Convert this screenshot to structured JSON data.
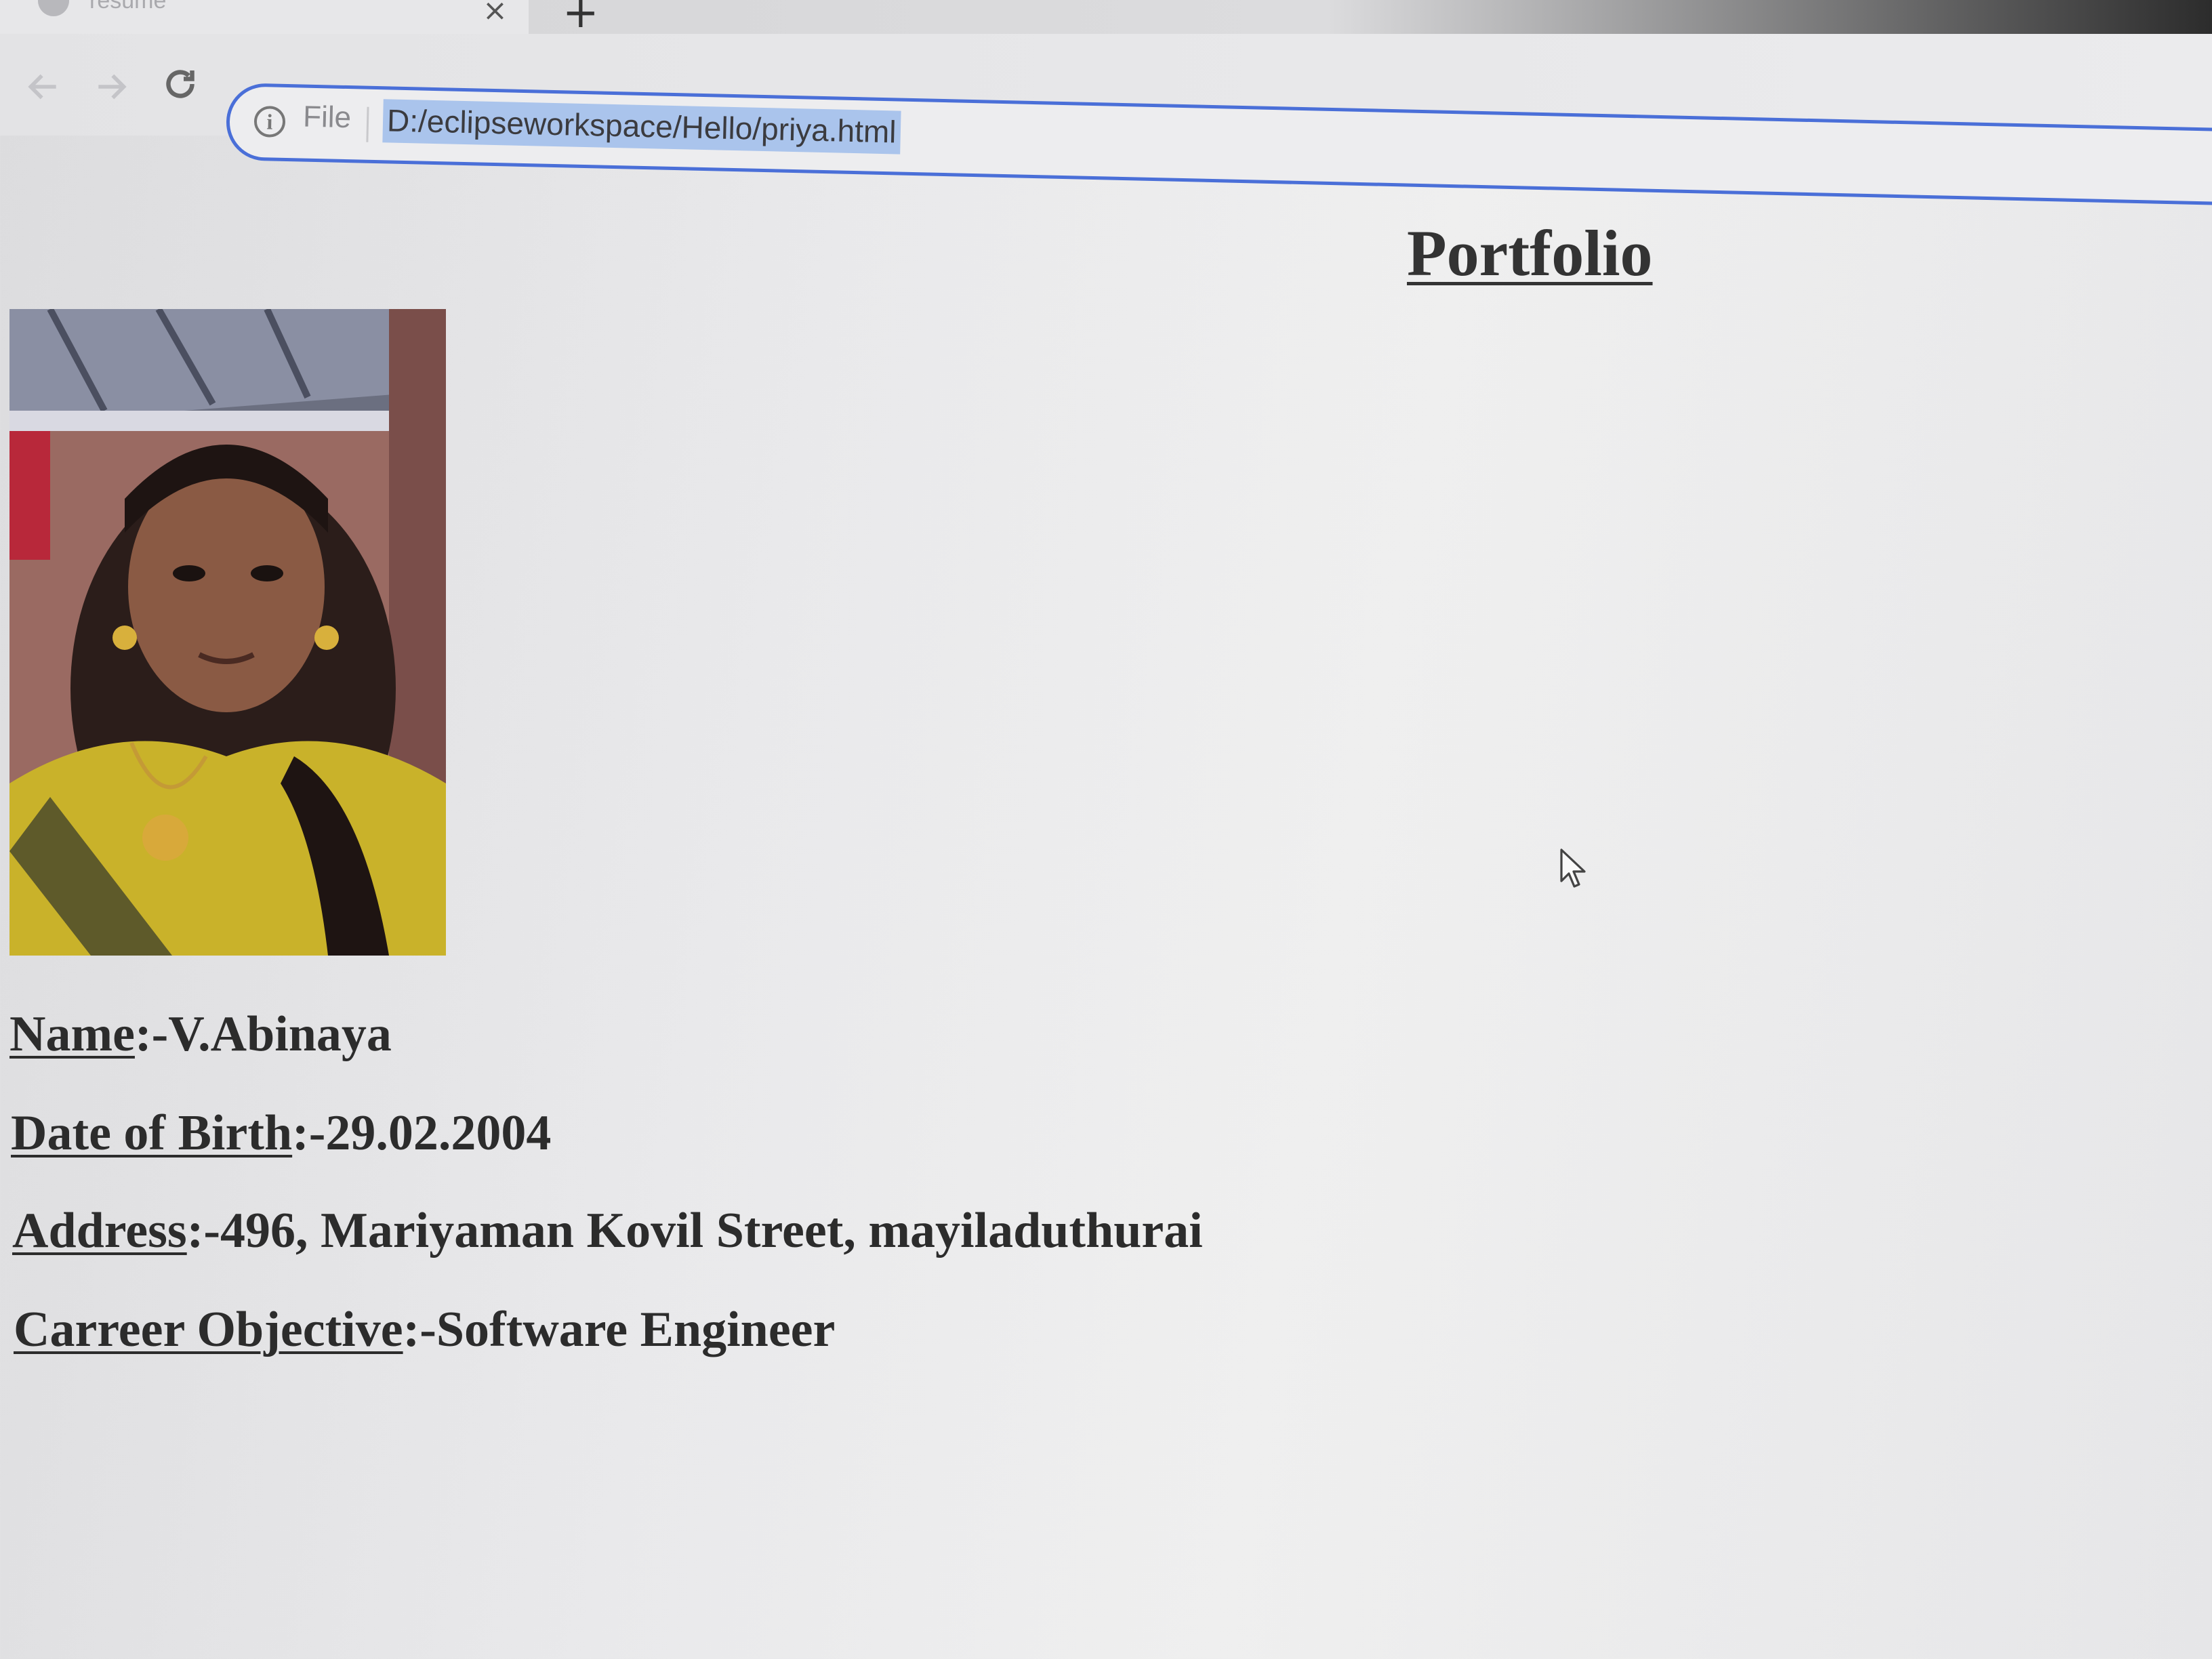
{
  "browser": {
    "tab": {
      "title": "resume",
      "close_glyph": "×"
    },
    "new_tab_glyph": "+",
    "nav": {
      "back_icon": "back-arrow-icon",
      "forward_icon": "forward-arrow-icon",
      "reload_icon": "reload-icon"
    },
    "omnibox": {
      "info_glyph": "i",
      "scheme_label": "File",
      "url": "D:/eclipseworkspace/Hello/priya.html",
      "url_selected": true,
      "focus_color": "#4a6fd8"
    }
  },
  "page": {
    "title": "Portfolio",
    "photo_alt": "profile-photo",
    "fields": [
      {
        "label": "Name",
        "value": ":-V.Abinaya"
      },
      {
        "label": "Date of Birth",
        "value": ":-29.02.2004"
      },
      {
        "label": "Address",
        "value": ":-496, Mariyaman Kovil Street, mayiladuthurai"
      },
      {
        "label": "Carreer Objective",
        "value": ":-Software Engineer"
      }
    ]
  },
  "mouse_cursor": "arrow-cursor-icon"
}
